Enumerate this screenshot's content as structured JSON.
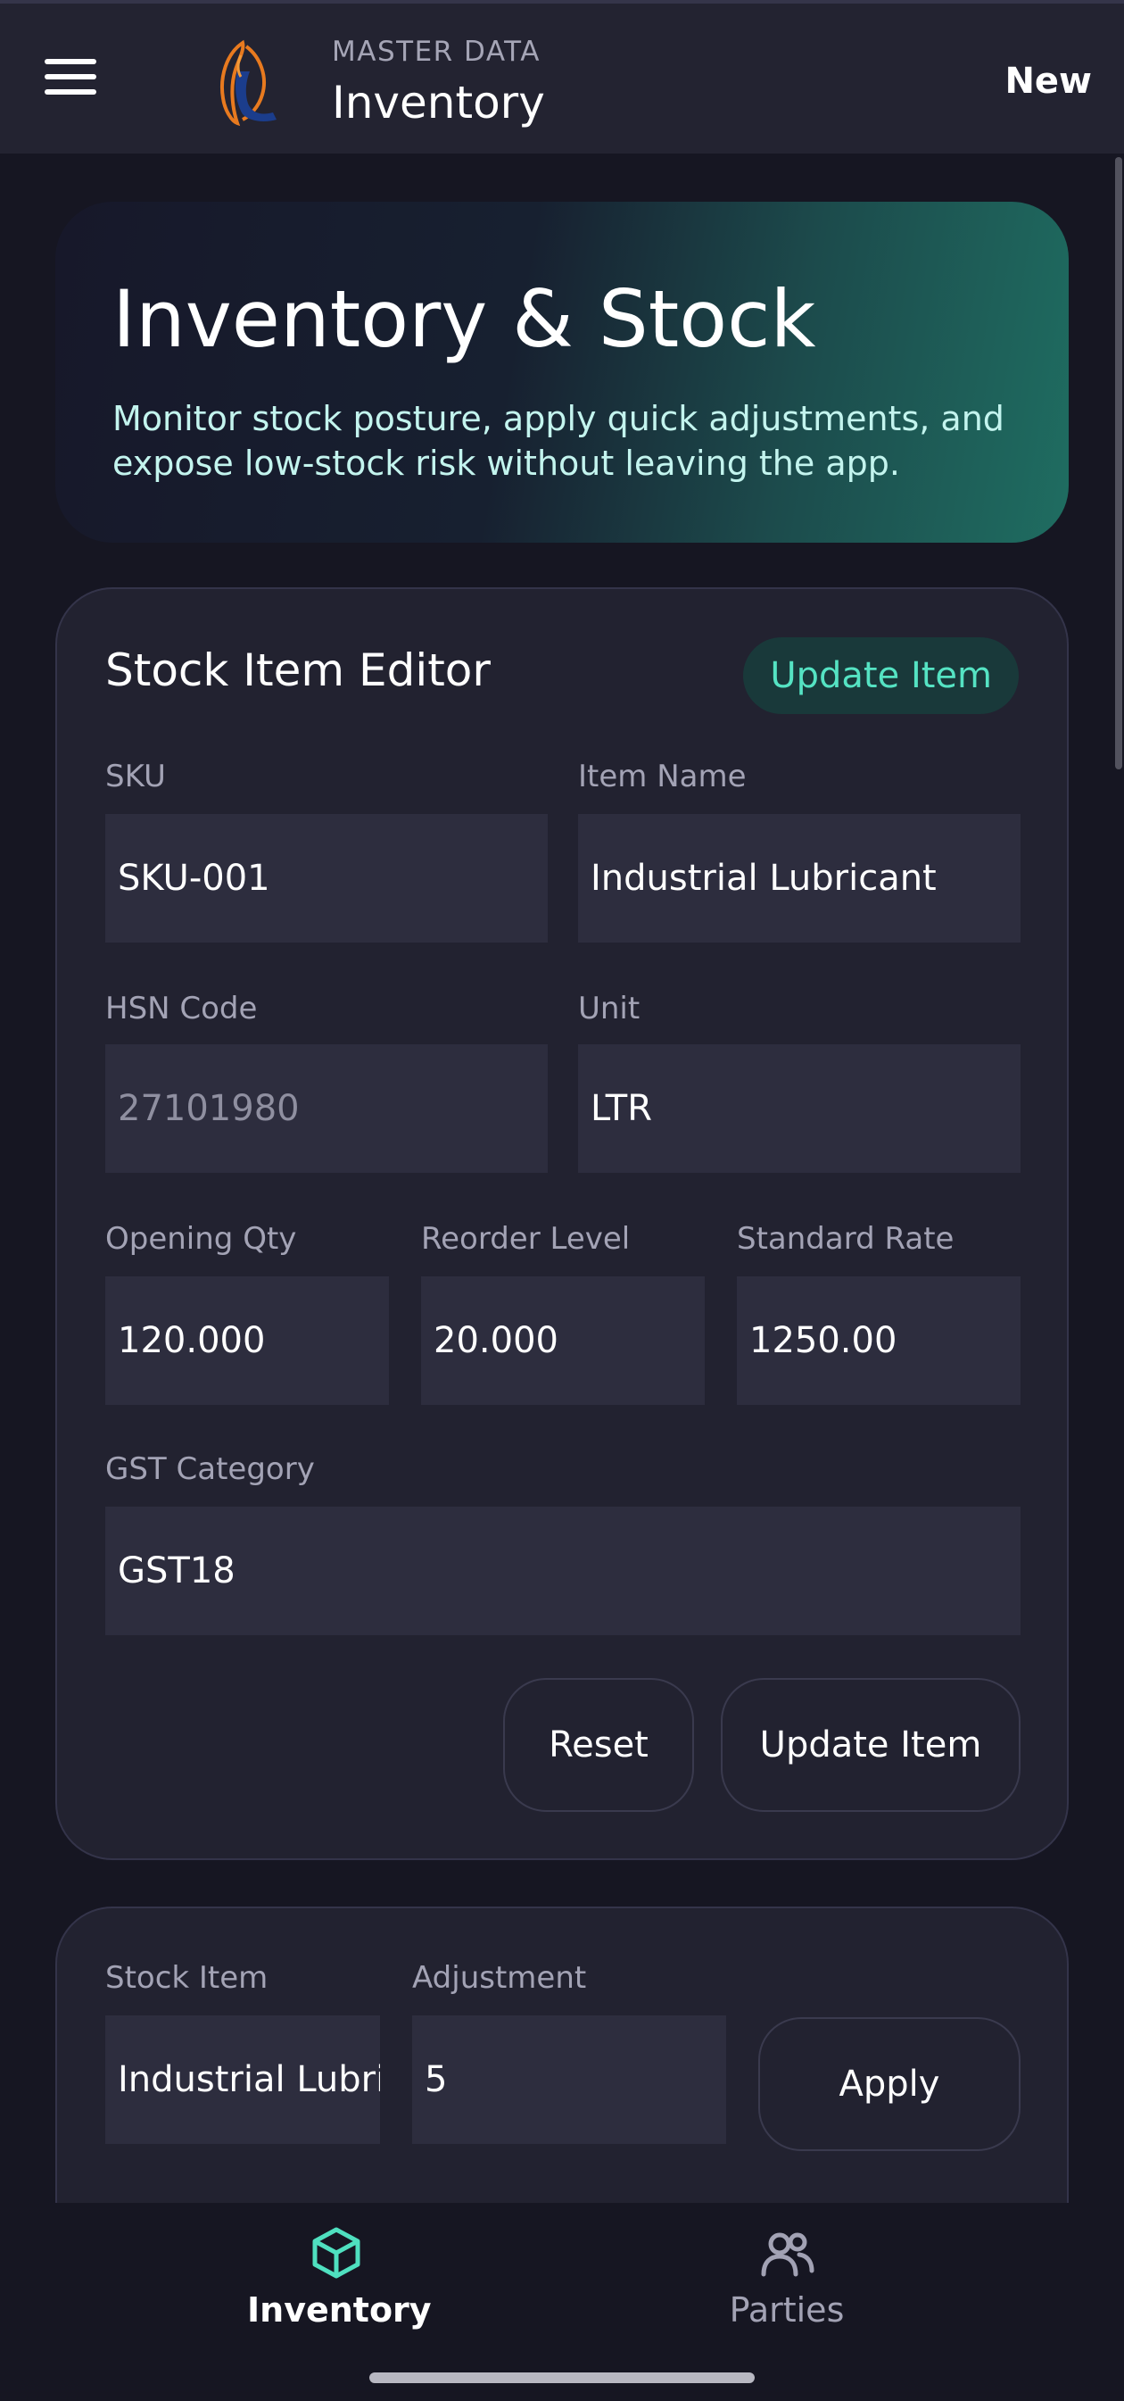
{
  "app_bar": {
    "subtitle": "MASTER DATA",
    "title": "Inventory",
    "new_label": "New",
    "logo": "shell-logo-icon"
  },
  "hero": {
    "title": "Inventory & Stock",
    "description": "Monitor stock posture, apply quick adjustments, and expose low-stock risk without leaving the app."
  },
  "editor": {
    "title": "Stock Item Editor",
    "badge": "Update Item",
    "sku_label": "SKU",
    "sku_value": "SKU-001",
    "item_name_label": "Item Name",
    "item_name_value": "Industrial Lubricant",
    "hsn_label": "HSN Code",
    "hsn_placeholder": "27101980",
    "unit_label": "Unit",
    "unit_value": "LTR",
    "opening_qty_label": "Opening Qty",
    "opening_qty_value": "120.000",
    "reorder_label": "Reorder Level",
    "reorder_value": "20.000",
    "rate_label": "Standard Rate",
    "rate_value": "1250.00",
    "gst_label": "GST Category",
    "gst_value": "GST18",
    "reset_label": "Reset",
    "update_label": "Update Item"
  },
  "adjust": {
    "stock_item_label": "Stock Item",
    "stock_item_value": "Industrial Lubricant",
    "adjustment_label": "Adjustment",
    "adjustment_value": "5",
    "apply_label": "Apply"
  },
  "bottom_nav": {
    "items": [
      {
        "label": "Inventory",
        "icon": "cube-icon",
        "active": true
      },
      {
        "label": "Parties",
        "icon": "people-icon",
        "active": false
      }
    ]
  },
  "colors": {
    "background": "#161622",
    "card": "#222230",
    "field": "#2d2d3e",
    "accent": "#55e3c3",
    "hero_gradient_end": "#1f6d61"
  }
}
